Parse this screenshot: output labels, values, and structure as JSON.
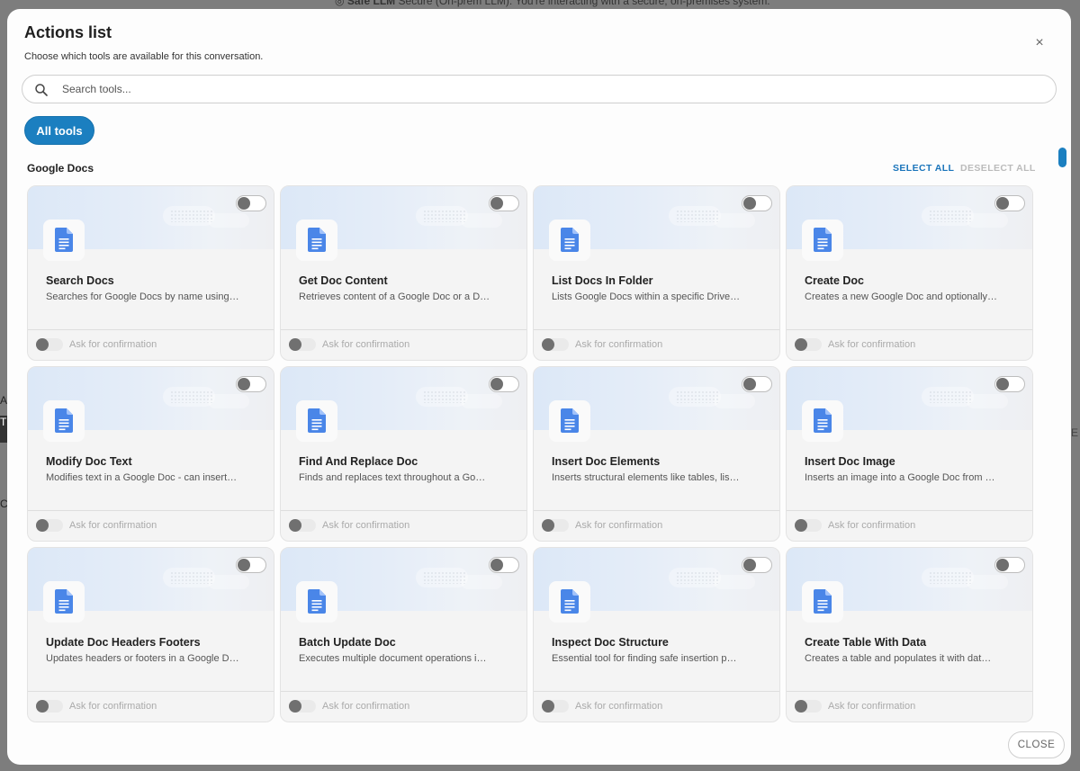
{
  "background": {
    "top_text_bold": "Safe LLM",
    "top_text": "Secure (On-prem LLM): You're interacting with a secure, on-premises system.",
    "left_fragments": [
      "A",
      "T",
      "C"
    ],
    "right_fragment": "E"
  },
  "modal": {
    "title": "Actions list",
    "subtitle": "Choose which tools are available for this conversation.",
    "close_icon": "close-icon",
    "close_glyph": "×",
    "close_label": "CLOSE"
  },
  "search": {
    "placeholder": "Search tools...",
    "value": ""
  },
  "filters": {
    "all_tools_label": "All tools"
  },
  "section": {
    "title": "Google Docs",
    "select_all": "SELECT ALL",
    "deselect_all": "DESELECT ALL"
  },
  "colors": {
    "accent": "#1b7fc0",
    "doc_icon": "#4a86e8"
  },
  "tools": [
    {
      "title": "Search Docs",
      "description": "Searches for Google Docs by name using…",
      "enabled": false,
      "confirm_label": "Ask for confirmation",
      "confirm": false
    },
    {
      "title": "Get Doc Content",
      "description": "Retrieves content of a Google Doc or a D…",
      "enabled": false,
      "confirm_label": "Ask for confirmation",
      "confirm": false
    },
    {
      "title": "List Docs In Folder",
      "description": "Lists Google Docs within a specific Drive…",
      "enabled": false,
      "confirm_label": "Ask for confirmation",
      "confirm": false
    },
    {
      "title": "Create Doc",
      "description": "Creates a new Google Doc and optionally…",
      "enabled": false,
      "confirm_label": "Ask for confirmation",
      "confirm": false
    },
    {
      "title": "Modify Doc Text",
      "description": "Modifies text in a Google Doc - can insert…",
      "enabled": false,
      "confirm_label": "Ask for confirmation",
      "confirm": false
    },
    {
      "title": "Find And Replace Doc",
      "description": "Finds and replaces text throughout a Go…",
      "enabled": false,
      "confirm_label": "Ask for confirmation",
      "confirm": false
    },
    {
      "title": "Insert Doc Elements",
      "description": "Inserts structural elements like tables, lis…",
      "enabled": false,
      "confirm_label": "Ask for confirmation",
      "confirm": false
    },
    {
      "title": "Insert Doc Image",
      "description": "Inserts an image into a Google Doc from …",
      "enabled": false,
      "confirm_label": "Ask for confirmation",
      "confirm": false
    },
    {
      "title": "Update Doc Headers Footers",
      "description": "Updates headers or footers in a Google D…",
      "enabled": false,
      "confirm_label": "Ask for confirmation",
      "confirm": false
    },
    {
      "title": "Batch Update Doc",
      "description": "Executes multiple document operations i…",
      "enabled": false,
      "confirm_label": "Ask for confirmation",
      "confirm": false
    },
    {
      "title": "Inspect Doc Structure",
      "description": "Essential tool for finding safe insertion p…",
      "enabled": false,
      "confirm_label": "Ask for confirmation",
      "confirm": false
    },
    {
      "title": "Create Table With Data",
      "description": "Creates a table and populates it with dat…",
      "enabled": false,
      "confirm_label": "Ask for confirmation",
      "confirm": false
    }
  ]
}
